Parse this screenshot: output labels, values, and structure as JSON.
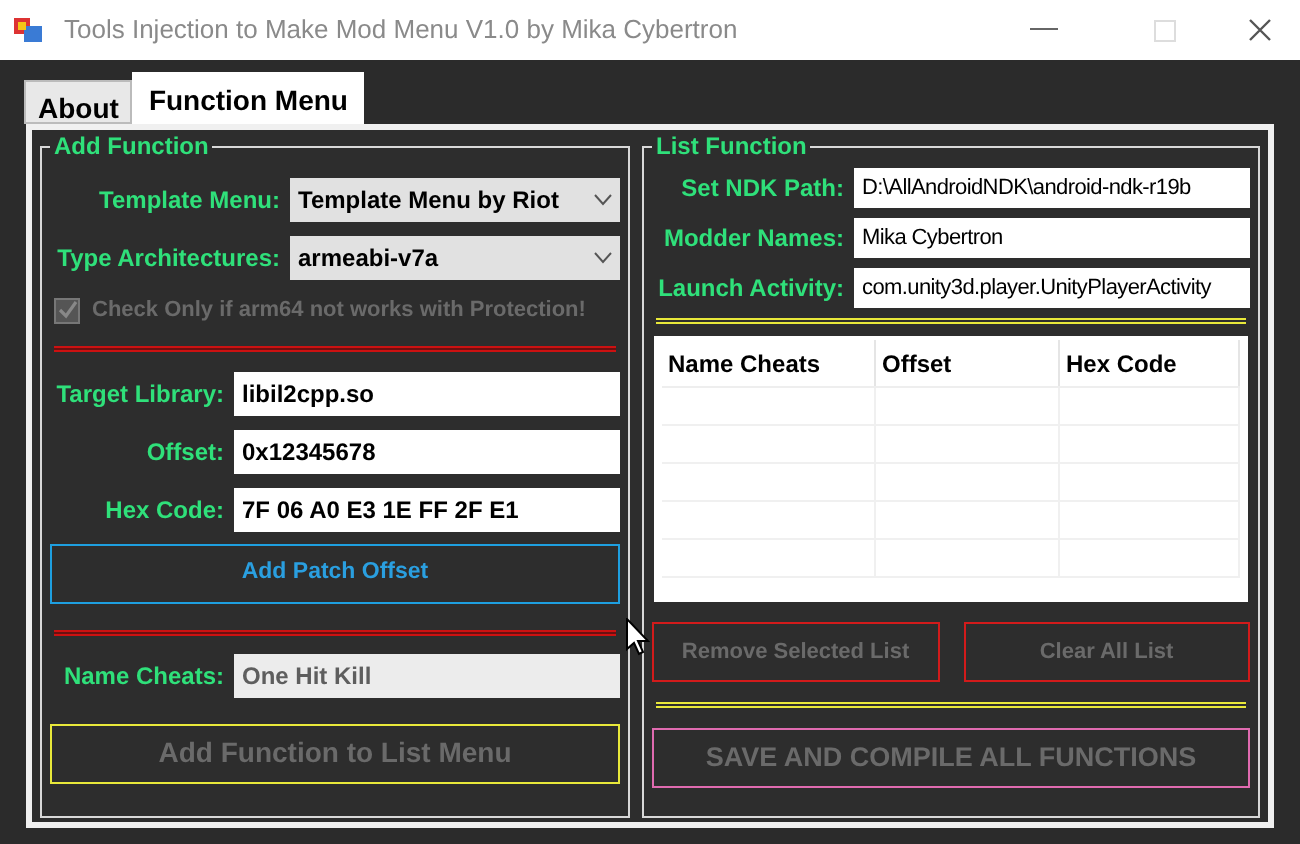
{
  "window": {
    "title": "Tools Injection to Make Mod Menu V1.0 by Mika Cybertron"
  },
  "tabs": [
    {
      "label": "About",
      "selected": false
    },
    {
      "label": "Function Menu",
      "selected": true
    }
  ],
  "add_function": {
    "title": "Add Function",
    "selects": [
      {
        "label": "Template Menu:",
        "value": "Template Menu by Riot"
      },
      {
        "label": "Type Architectures:",
        "value": "armeabi-v7a"
      }
    ],
    "checkbox": {
      "label": "Check Only if arm64 not works with Protection!",
      "checked": true,
      "disabled": true
    },
    "fields": [
      {
        "label": "Target Library:",
        "value": "libil2cpp.so"
      },
      {
        "label": "Offset:",
        "value": "0x12345678"
      },
      {
        "label": "Hex Code:",
        "value": "7F 06 A0 E3 1E FF 2F E1"
      }
    ],
    "patch_button": {
      "label": "Add Patch Offset",
      "disabled": false
    },
    "name_field": {
      "label": "Name Cheats:",
      "value": "One Hit Kill",
      "disabled": true
    },
    "add_button": {
      "label": "Add Function to List Menu",
      "disabled": true
    }
  },
  "list_function": {
    "title": "List Function",
    "fields": [
      {
        "label": "Set NDK Path:",
        "value": "D:\\AllAndroidNDK\\android-ndk-r19b"
      },
      {
        "label": "Modder Names:",
        "value": "Mika Cybertron"
      },
      {
        "label": "Launch Activity:",
        "value": "com.unity3d.player.UnityPlayerActivity"
      }
    ],
    "table": {
      "columns": [
        "Name Cheats",
        "Offset",
        "Hex Code"
      ]
    },
    "buttons": [
      {
        "label": "Remove Selected List",
        "disabled": true
      },
      {
        "label": "Clear All List",
        "disabled": true
      }
    ],
    "save_button": {
      "label": "SAVE AND COMPILE ALL FUNCTIONS",
      "disabled": true
    }
  }
}
